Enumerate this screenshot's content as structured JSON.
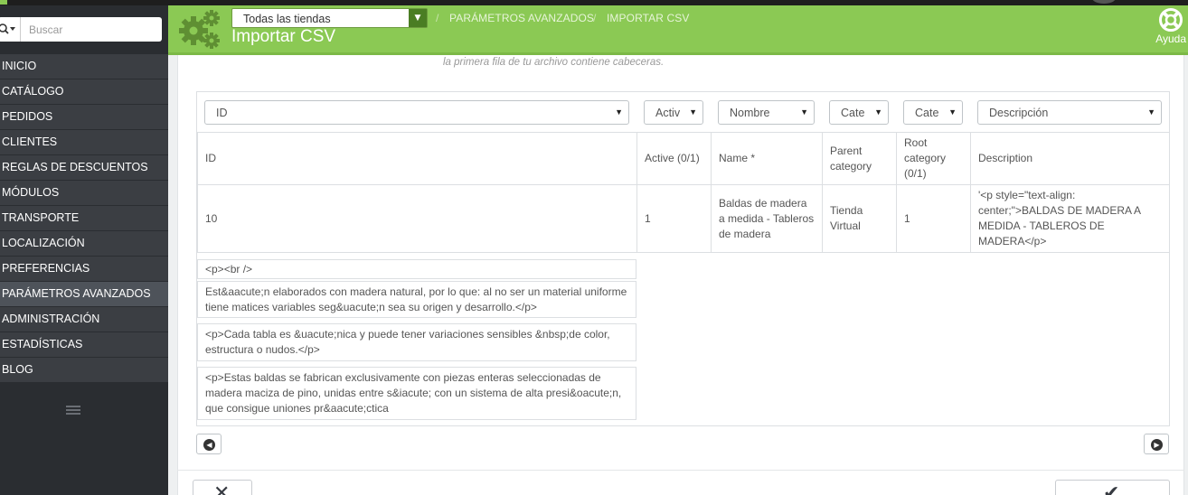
{
  "sidebar": {
    "search_placeholder": "Buscar",
    "items": [
      {
        "label": "INICIO"
      },
      {
        "label": "CATÁLOGO"
      },
      {
        "label": "PEDIDOS"
      },
      {
        "label": "CLIENTES"
      },
      {
        "label": "REGLAS DE DESCUENTOS"
      },
      {
        "label": "MÓDULOS"
      },
      {
        "label": "TRANSPORTE"
      },
      {
        "label": "LOCALIZACIÓN"
      },
      {
        "label": "PREFERENCIAS"
      },
      {
        "label": "PARÁMETROS AVANZADOS"
      },
      {
        "label": "ADMINISTRACIÓN"
      },
      {
        "label": "ESTADÍSTICAS"
      },
      {
        "label": "BLOG"
      }
    ],
    "active_item": "PARÁMETROS AVANZADOS"
  },
  "header": {
    "shop_select": "Todas las tiendas",
    "breadcrumb": [
      "PARÁMETROS AVANZADOS",
      "IMPORTAR CSV"
    ],
    "breadcrumb_sep": "/",
    "title": "Importar CSV",
    "help_label": "Ayuda"
  },
  "hint": "la primera fila de tu archivo contiene cabeceras.",
  "column_selects": [
    "ID",
    "Activ",
    "Nombre",
    "Cate",
    "Cate",
    "Descripción"
  ],
  "table": {
    "headers": [
      "ID",
      "Active (0/1)",
      "Name *",
      "Parent category",
      "Root category (0/1)",
      "Description"
    ],
    "row": [
      "10",
      "1",
      "Baldas de madera a medida - Tableros de madera",
      "Tienda Virtual",
      "1",
      "'<p style=\"text-align: center;\">BALDAS DE MADERA A MEDIDA - TABLEROS DE MADERA</p>"
    ]
  },
  "extra_rows": [
    "<p><br />",
    "Est&aacute;n elaborados con madera natural, por lo que: al no ser un material uniforme tiene matices variables seg&uacute;n sea su origen y desarrollo.</p>",
    "<p>Cada tabla es &uacute;nica y puede tener variaciones sensibles &nbsp;de color, estructura o nudos.</p>",
    "<p>Estas baldas se fabrican exclusivamente con piezas enteras seleccionadas de madera maciza de pino, unidas entre s&iacute; con un sistema de alta presi&oacute;n, que consigue uniones pr&aacute;ctica"
  ],
  "colors": {
    "header_green": "#8bc954",
    "sidebar_bg": "#2a2d31",
    "menu_item_bg": "#3b3e43",
    "menu_active_bg": "#4e535a"
  }
}
